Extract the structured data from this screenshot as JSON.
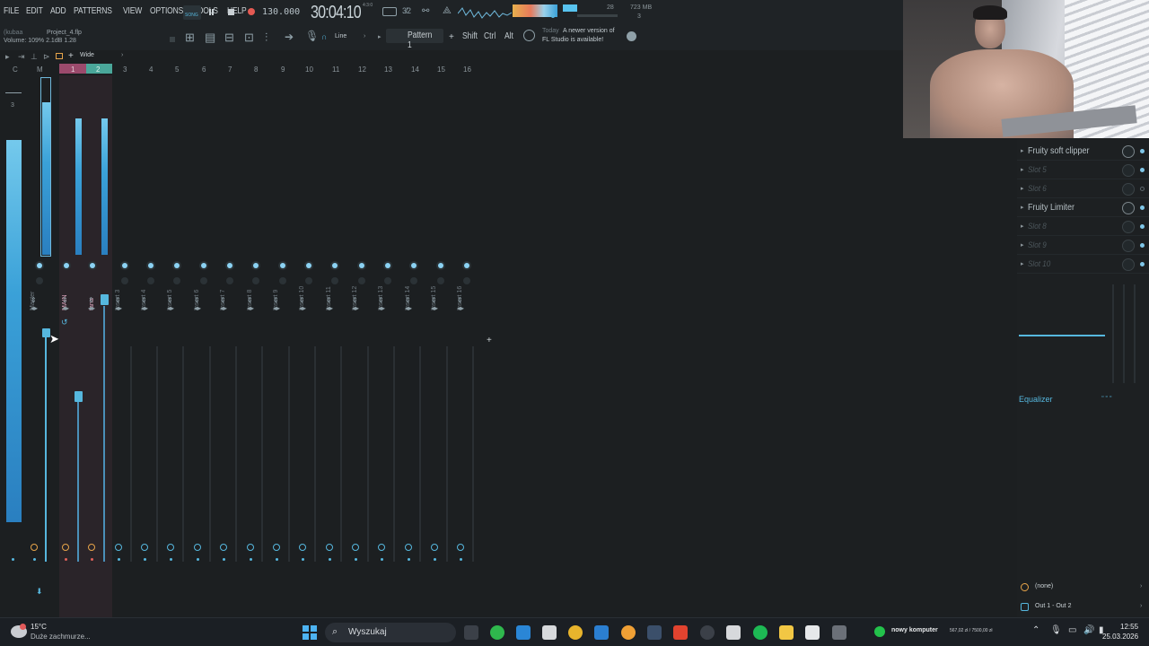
{
  "menu": [
    "FILE",
    "EDIT",
    "ADD",
    "PATTERNS",
    "VIEW",
    "OPTIONS",
    "TOOLS",
    "HELP"
  ],
  "transport": {
    "song_label": "SONG",
    "tempo": "130.000",
    "time": "30:04:10",
    "time_sig": "4:3:0",
    "cpu_value": "28",
    "mem": "723 MB",
    "poly": "3"
  },
  "project": {
    "user": "(kubaa",
    "file": "Project_4.flp",
    "volume_hint": "Volume: 109% 2.1dB 1.28"
  },
  "toolbar": {
    "snap": "Line",
    "pattern": "Pattern 1",
    "shift": "Shift",
    "ctrl": "Ctrl",
    "alt": "Alt",
    "news_today": "Today",
    "news_line1": "A newer version of",
    "news_line2": "FL Studio is available!"
  },
  "mixer": {
    "view_mode": "Wide",
    "col_headers": [
      "C",
      "M",
      "1",
      "2",
      "3",
      "4",
      "5",
      "6",
      "7",
      "8",
      "9",
      "10",
      "11",
      "12",
      "13",
      "14",
      "15",
      "16"
    ],
    "tracks": [
      "Master",
      "MAIN",
      "tana",
      "Insert 3",
      "Insert 4",
      "Insert 5",
      "Insert 6",
      "Insert 7",
      "Insert 8",
      "Insert 9",
      "Insert 10",
      "Insert 11",
      "Insert 12",
      "Insert 13",
      "Insert 14",
      "Insert 15",
      "Insert 16"
    ],
    "current_num": "3"
  },
  "effects": {
    "slots": [
      {
        "label": "Fruity soft clipper",
        "empty": false
      },
      {
        "label": "Slot 5",
        "empty": true
      },
      {
        "label": "Slot 6",
        "empty": true
      },
      {
        "label": "Fruity Limiter",
        "empty": false
      },
      {
        "label": "Slot 8",
        "empty": true
      },
      {
        "label": "Slot 9",
        "empty": true
      },
      {
        "label": "Slot 10",
        "empty": true
      }
    ],
    "equalizer": "Equalizer",
    "input": "(none)",
    "output": "Out 1 - Out 2"
  },
  "taskbar": {
    "weather_temp": "15°C",
    "weather_desc": "Duże zachmurze...",
    "search": "Wyszukaj",
    "wallet_title": "nowy komputer",
    "wallet_value": "567,02 zł / 7500,00 zł",
    "clock_time": "12:55",
    "clock_date": "25.03.2026"
  },
  "colors": {
    "accent": "#56b7de",
    "meter": "#3aa1d8",
    "highlight_track": "#3a2a35",
    "taskbar": "#1b1f24"
  }
}
